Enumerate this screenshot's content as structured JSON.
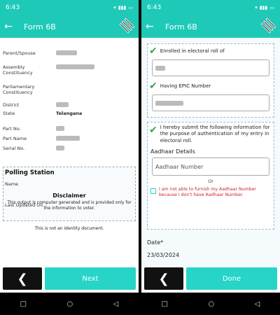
{
  "status_bar": {
    "time": "6:43",
    "icons": "wifi, VoLTE, signal, battery"
  },
  "left": {
    "appbar": {
      "title": "Form 6B"
    },
    "fields": [
      {
        "label": "Parent/Spouse"
      },
      {
        "label": "Assembly Constituency"
      },
      {
        "label": "Parliamentary Constituency"
      },
      {
        "label": "District"
      },
      {
        "label": "State",
        "value": "Telangana"
      },
      {
        "label": "Part No."
      },
      {
        "label": "Part Name"
      },
      {
        "label": "Serial No."
      }
    ],
    "polling": {
      "title": "Polling Station",
      "name_label": "Name",
      "updated_label": "Last Updated On"
    },
    "disclaimer": {
      "title": "Disclaimer",
      "text": "This output is computer generated and is provided only for the information to voter.",
      "text2": "This is not an identity document."
    },
    "next_label": "Next"
  },
  "right": {
    "appbar": {
      "title": "Form 6B"
    },
    "enrolled_label": "Enrolled in electoral roll of",
    "epic_label": "Having EPIC Number",
    "submit_text": "I hereby submit the following information for the purpose of authentication of my entry in electoral roll.",
    "aadhaar_title": "Aadhaar Details",
    "aadhaar_placeholder": "Aadhaar Number",
    "or_label": "Or",
    "warning_text": "I am not able to furnish my Aadhaar Number because I don't have Aadhaar Number.",
    "date_label": "Date*",
    "date_value": "23/03/2024",
    "done_label": "Done"
  },
  "nav": {
    "recents": "□",
    "home": "○",
    "back": "◁"
  }
}
